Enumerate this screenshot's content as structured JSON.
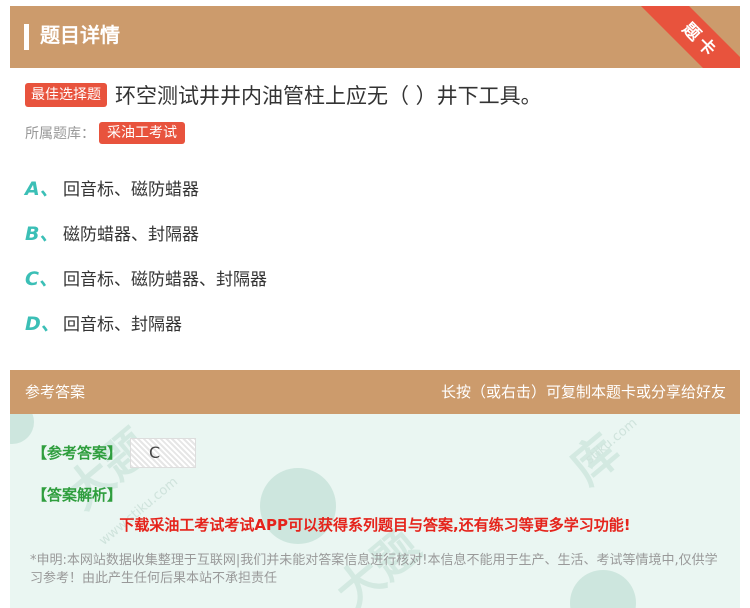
{
  "header": {
    "title": "题目详情",
    "ribbon": "题卡"
  },
  "question": {
    "type": "最佳选择题",
    "text": "环空测试井井内油管柱上应无（ ）井下工具。"
  },
  "bank": {
    "label": "所属题库：",
    "tag": "采油工考试"
  },
  "options": [
    {
      "letter": "A、",
      "text": "回音标、磁防蜡器"
    },
    {
      "letter": "B、",
      "text": "磁防蜡器、封隔器"
    },
    {
      "letter": "C、",
      "text": "回音标、磁防蜡器、封隔器"
    },
    {
      "letter": "D、",
      "text": "回音标、封隔器"
    }
  ],
  "answer_section": {
    "title": "参考答案",
    "hint": "长按（或右击）可复制本题卡或分享给好友",
    "answer_label": "【参考答案】",
    "answer_value": "C",
    "analysis_label": "【答案解析】",
    "promo": "下载采油工考试考试APP可以获得系列题目与答案,还有练习等更多学习功能!",
    "disclaimer": "*申明:本网站数据收集整理于互联网|我们并未能对答案信息进行核对!本信息不能用于生产、生活、考试等情境中,仅供学习参考！由此产生任何后果本站不承担责任"
  },
  "colors": {
    "header_bg": "#cc9b6c",
    "accent_red": "#e8533d",
    "option_letter": "#3bbfb6",
    "answer_green": "#2f9e3e",
    "promo_red": "#e5231b",
    "answer_bg": "#eaf6f2"
  }
}
